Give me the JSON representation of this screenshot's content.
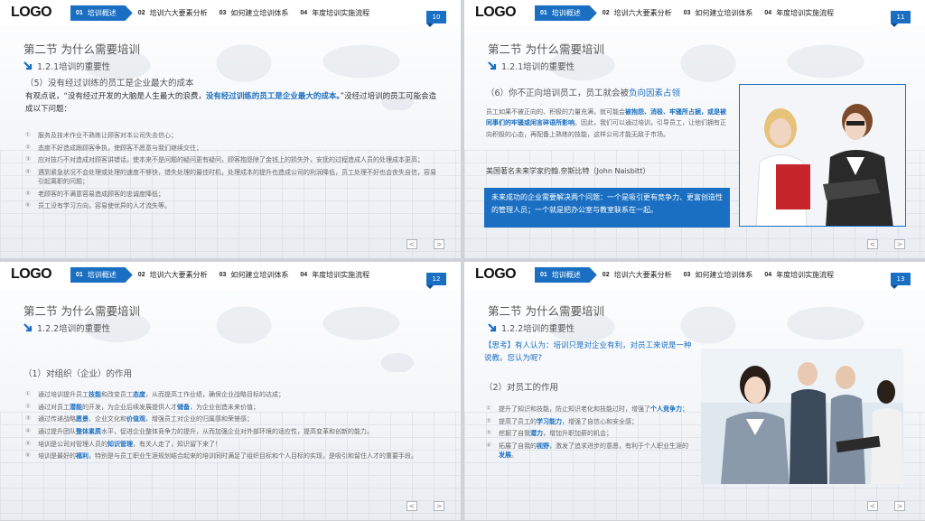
{
  "brand": {
    "logo": "LOGO",
    "accent": "#1a6fc2"
  },
  "nav": [
    {
      "num": "01",
      "label": "培训概述"
    },
    {
      "num": "02",
      "label": "培训六大要素分析"
    },
    {
      "num": "03",
      "label": "如何建立培训体系"
    },
    {
      "num": "04",
      "label": "年度培训实施流程"
    }
  ],
  "footer": {
    "prev": "<",
    "next": ">"
  },
  "slides": [
    {
      "page": "10",
      "title": "第二节  为什么需要培训",
      "subtitle": "1.2.1培训的重要性",
      "heading": "（5）没有经过训练的员工是企业最大的成本",
      "intro_a": "有观点说，“没有经过开发的大脑是人生最大的浪费，",
      "intro_b": "没有经过训练的员工是企业最大的成本。",
      "intro_c": "”没经过培训的员工可能会造成以下问题：",
      "items": [
        {
          "n": "①",
          "text": "服务及技术作业不熟练让顾客对本公司失去信心；"
        },
        {
          "n": "②",
          "text": "态度不好造成跟顾客争执，使顾客不愿意与我们继续交往；"
        },
        {
          "n": "③",
          "text": "应对技巧不对造成对顾客讲错话，使本来不是问题的疑问更有疑问，顾客抱怨除了金钱上的损失外，安抚的过程造成人员的处理成本更高；"
        },
        {
          "n": "④",
          "text": "遇到紧急状况不会处理或处理的速度不够快，错失处理的最佳时机，处理成本的提升也造成公司的利润降低，员工处理不好也会丧失自信，容易引起离职的问题；"
        },
        {
          "n": "⑤",
          "text": "老顾客的不满意容易造成顾客的忠诚度降低；"
        },
        {
          "n": "⑥",
          "text": "员工没有学习方向，容易使优异的人才流失等。"
        }
      ]
    },
    {
      "page": "11",
      "title": "第二节  为什么需要培训",
      "subtitle": "1.2.1培训的重要性",
      "heading_a": "（6）你不正向培训员工，员工就会被",
      "heading_b": "负向因素占领",
      "body_a": "员工如果不被正向的、积极的力量充满，就可能会",
      "body_b": "被抱怨、消极、牢骚所占据，或是被同事们的牢骚或闲言碎语所影响",
      "body_c": "。因此，我们可以通过培训，引导员工，让他们拥有正向积极的心态，再配备上熟练的技能，这样公司才能无敌于市场。",
      "quote_author": "美国著名未来学家约翰.奈斯比特（John Naisbitt）",
      "callout": "未来成功的企业需要解决两个问题：一个是吸引更有竞争力、更富创造性的管理人员；一个就是把办公室与教室联系在一起。"
    },
    {
      "page": "12",
      "title": "第二节  为什么需要培训",
      "subtitle": "1.2.2培训的重要性",
      "heading": "（1）对组织（企业）的作用",
      "items": [
        {
          "n": "①",
          "a": "通过培训提升员工",
          "b": "技能",
          "c": "和改变员工",
          "d": "态度",
          "e": "，从而提高工作业绩，确保企业战略目标的达成；"
        },
        {
          "n": "②",
          "a": "通过对员工",
          "b": "潜能",
          "c": "的开发，为企业后续发展提供人才",
          "d": "储备",
          "e": "，为企业创造未来价值；"
        },
        {
          "n": "③",
          "a": "通过传递战略",
          "b": "愿景",
          "c": "、企业文化和",
          "d": "价值观",
          "e": "，增强员工对企业的归属感和荣誉感；"
        },
        {
          "n": "④",
          "a": "通过提升团队",
          "b": "整体素质",
          "c": "水平，促进企业整体竞争力的提升，从而加强企业对外部环境的适应性，提高变革和创新的能力。",
          "d": "",
          "e": ""
        },
        {
          "n": "⑤",
          "a": "培训是公司对管理人员的",
          "b": "知识管理",
          "c": "，有关人走了，知识留下来了！",
          "d": "",
          "e": ""
        },
        {
          "n": "⑥",
          "a": "培训是最好的",
          "b": "福利",
          "c": "，特别是与员工职业生涯规划结合起来的培训同时满足了组织目标和个人目标的实现，是吸引和留住人才的重要手段。",
          "d": "",
          "e": ""
        }
      ]
    },
    {
      "page": "13",
      "title": "第二节  为什么需要培训",
      "subtitle": "1.2.2培训的重要性",
      "think": "【思考】有人认为：培训只是对企业有利，对员工来说是一种说教。您认为呢?",
      "heading": "（2）对员工的作用",
      "items": [
        {
          "n": "①",
          "a": "提升了知识和技能，防止知识老化和技能过时，增强了",
          "b": "个人竞争力",
          "c": "；"
        },
        {
          "n": "②",
          "a": "提高了员工的",
          "b": "学习能力",
          "c": "，增强了自信心和安全感；"
        },
        {
          "n": "③",
          "a": "挖掘了自我",
          "b": "潜力",
          "c": "，增加升职加薪的机会；"
        },
        {
          "n": "④",
          "a": "拓展了自我的",
          "b": "视野",
          "c": "，激发了追求进步的意愿，有利于个人职业生涯的",
          "d": "发展",
          "e": "。"
        }
      ]
    }
  ]
}
